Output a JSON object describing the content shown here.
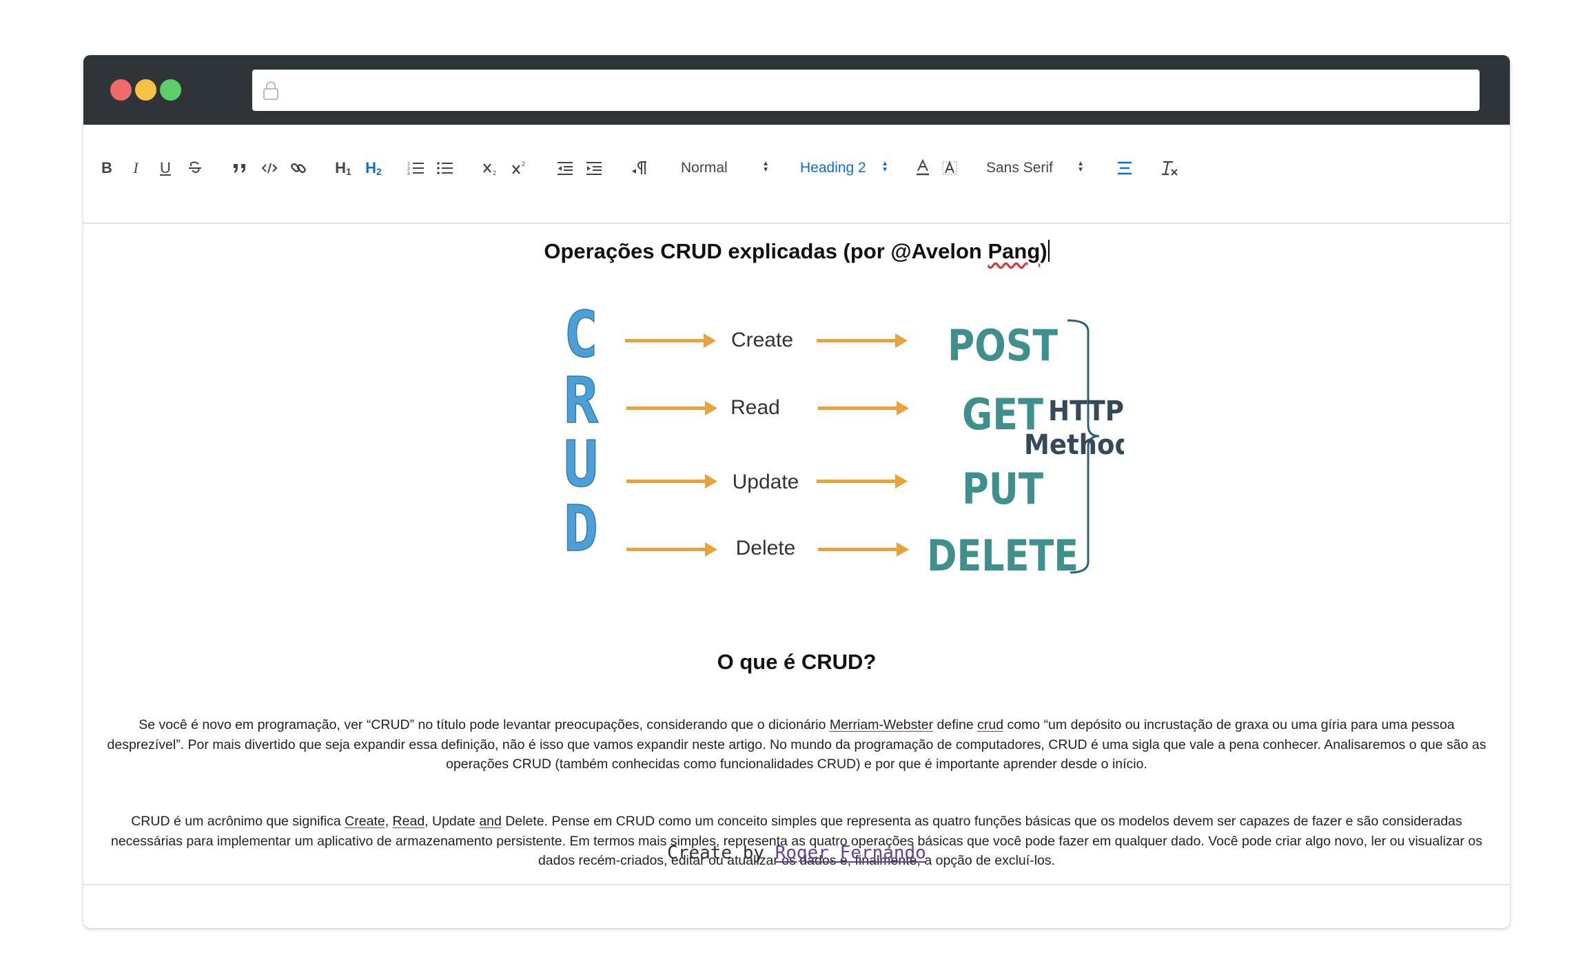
{
  "toolbar": {
    "format_picker": "Normal",
    "heading_picker": "Heading 2",
    "font_picker": "Sans Serif",
    "h1_label": "H",
    "h1_sub": "1",
    "h2_label": "H",
    "h2_sub": "2",
    "bold_label": "B",
    "italic_label": "I",
    "underline_label": "U"
  },
  "document": {
    "title_prefix": "Operações CRUD explicadas (por @Avelon ",
    "title_underlined": "Pang",
    "title_suffix": ")",
    "figure": {
      "letters": [
        "C",
        "R",
        "U",
        "D"
      ],
      "actions": [
        "Create",
        "Read",
        "Update",
        "Delete"
      ],
      "methods": [
        "POST",
        "GET",
        "PUT",
        "DELETE"
      ],
      "group_label_1": "HTTP",
      "group_label_2": "Methods"
    },
    "section_heading": "O que é CRUD?",
    "p1_a": "Se você é novo em programação, ver “CRUD” no título pode levantar preocupações, considerando que o dicionário ",
    "p1_link1": "Merriam-Webster",
    "p1_b": " define ",
    "p1_link2": "crud",
    "p1_c": " como “um depósito ou incrustação de graxa ou uma gíria para uma pessoa desprezível”. Por mais divertido que seja expandir essa definição, não é isso que vamos expandir neste artigo. No mundo da programação de computadores, CRUD é uma sigla que vale a pena conhecer. Analisaremos o que são as operações CRUD (também conhecidas como funcionalidades CRUD) e por que é importante aprender desde o início.",
    "p2_a": "CRUD é um acrônimo que significa ",
    "p2_w1": "Create",
    "p2_b": ", ",
    "p2_w2": "Read",
    "p2_c": ", Update ",
    "p2_w3": "and",
    "p2_d": " Delete. Pense em CRUD como um conceito simples que representa as quatro funções básicas que os modelos devem ser capazes de fazer e são consideradas necessárias para implementar um aplicativo de armazenamento persistente. Em termos mais simples, representa as quatro operações básicas que você pode fazer em qualquer dado. Você pode criar algo novo, ler ou visualizar os dados recém-criados, editar ou atualizar os dados e, finalmente, a opção de excluí-los."
  },
  "footer": {
    "prefix": "Create by ",
    "author": "Roger Fernando"
  },
  "colors": {
    "letters": "#4da0d6",
    "arrows": "#e8a33c",
    "methods": "#3e8f8d",
    "label": "#34495a",
    "active": "#0d6cd8"
  }
}
